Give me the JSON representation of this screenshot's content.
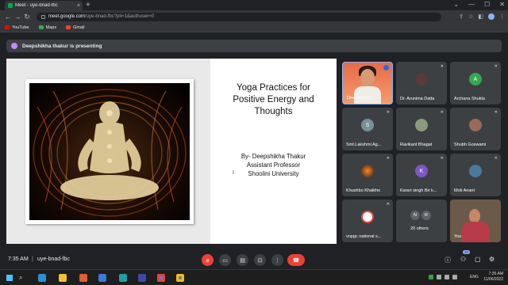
{
  "browser": {
    "tab_title": "Meet - uye-bnad-fbc",
    "tab_close": "×",
    "new_tab": "+",
    "url_domain": "meet.google.com",
    "url_path": "/uye-bnad-fbc?pli=1&authuser=0",
    "bookmarks": [
      {
        "label": "YouTube",
        "color": "#ff0000"
      },
      {
        "label": "Maps",
        "color": "#34a853"
      },
      {
        "label": "Gmail",
        "color": "#ea4335"
      }
    ]
  },
  "banner": {
    "text": "Deepshikha thakur is presenting"
  },
  "slide": {
    "title_lines": [
      "Yoga Practices for",
      "Positive Energy and",
      "Thoughts"
    ],
    "byline_lines": [
      "By- Deepshikha Thakur",
      "Assistant Professor",
      "Shoolini University"
    ]
  },
  "participants": [
    {
      "name": "Deepshikha t...",
      "kind": "speaker"
    },
    {
      "name": "Dr. Arunima Datta",
      "kind": "avatar",
      "color": "#3c4043"
    },
    {
      "name": "Archana Shukla",
      "kind": "initial",
      "initial": "A",
      "color": "#34a853"
    },
    {
      "name": "Smt.Lakshmi Ag...",
      "kind": "initial",
      "initial": "S",
      "color": "#78909c"
    },
    {
      "name": "Ravikant Bhagat",
      "kind": "avatar",
      "color": "#5f6368"
    },
    {
      "name": "Shubh Goswami",
      "kind": "avatar",
      "color": "#5f6368"
    },
    {
      "name": "Khushbu Khalkho",
      "kind": "avatar",
      "color": "#8a4b1a"
    },
    {
      "name": "Karan singh Bir k...",
      "kind": "initial",
      "initial": "K",
      "color": "#7e57c2"
    },
    {
      "name": "Moti Anant",
      "kind": "avatar",
      "color": "#5f6368"
    },
    {
      "name": "vnpgc national s...",
      "kind": "avatar",
      "color": "#ffffff"
    },
    {
      "name": "20 others",
      "kind": "others",
      "initials": [
        "N",
        "R"
      ]
    },
    {
      "name": "You",
      "kind": "you"
    }
  ],
  "meeting": {
    "time": "7:35 AM",
    "separator": "|",
    "code": "uye-bnad-fbc",
    "people_count": "32"
  },
  "taskbar": {
    "lang": "ENG",
    "clock_time": "7:35 AM",
    "clock_date": "11/06/2022"
  }
}
